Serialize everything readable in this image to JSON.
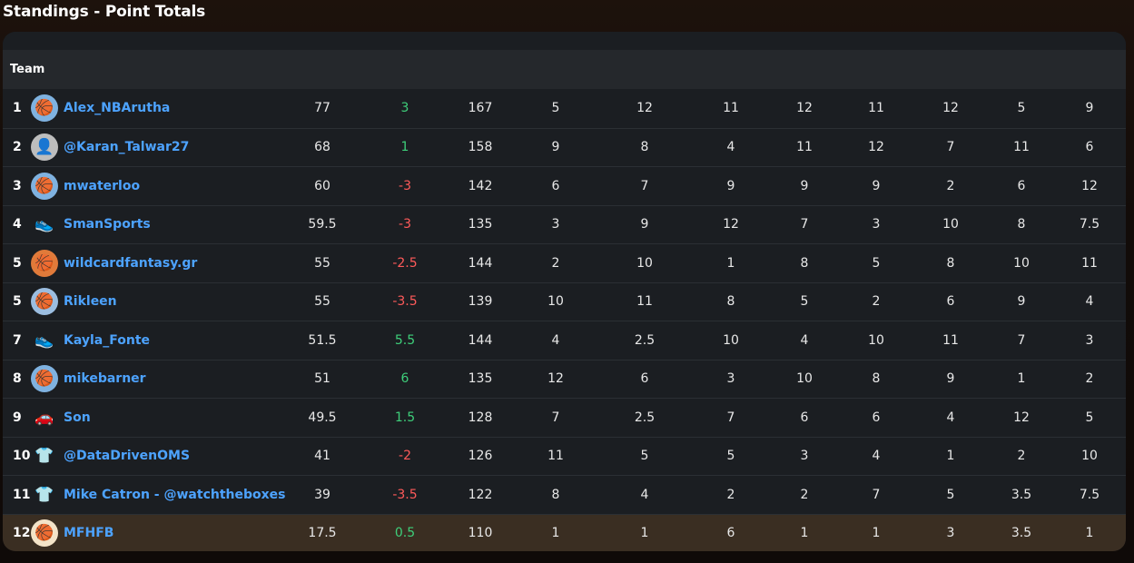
{
  "page": {
    "title": "Standings - Point Totals"
  },
  "table": {
    "header_team": "Team",
    "rows": [
      {
        "rank": "1",
        "team": "Alex_NBArutha",
        "avatar_icon": "basketball-hoop-icon",
        "avatar_glyph": "🏀",
        "avatar_bg": "#7fb2e0",
        "total": "77",
        "change": "3",
        "change_sign": "pos",
        "c1": "167",
        "c2": "5",
        "c3": "12",
        "c4": "11",
        "c5": "12",
        "c6": "11",
        "c7": "12",
        "c8": "5",
        "c9": "9"
      },
      {
        "rank": "2",
        "team": "@Karan_Talwar27",
        "avatar_icon": "person-photo-icon",
        "avatar_glyph": "👤",
        "avatar_bg": "#bdbdbd",
        "total": "68",
        "change": "1",
        "change_sign": "pos",
        "c1": "158",
        "c2": "9",
        "c3": "8",
        "c4": "4",
        "c5": "11",
        "c6": "12",
        "c7": "7",
        "c8": "11",
        "c9": "6"
      },
      {
        "rank": "3",
        "team": "mwaterloo",
        "avatar_icon": "basketball-hoop-icon",
        "avatar_glyph": "🏀",
        "avatar_bg": "#7fb2e0",
        "total": "60",
        "change": "-3",
        "change_sign": "neg",
        "c1": "142",
        "c2": "6",
        "c3": "7",
        "c4": "9",
        "c5": "9",
        "c6": "9",
        "c7": "2",
        "c8": "6",
        "c9": "12"
      },
      {
        "rank": "4",
        "team": "SmanSports",
        "avatar_icon": "sneaker-icon",
        "avatar_glyph": "👟",
        "avatar_bg": "transparent",
        "total": "59.5",
        "change": "-3",
        "change_sign": "neg",
        "c1": "135",
        "c2": "3",
        "c3": "9",
        "c4": "12",
        "c5": "7",
        "c6": "3",
        "c7": "10",
        "c8": "8",
        "c9": "7.5"
      },
      {
        "rank": "5",
        "team": "wildcardfantasy.gr",
        "avatar_icon": "basketball-icon",
        "avatar_glyph": "🏀",
        "avatar_bg": "#e07a3a",
        "total": "55",
        "change": "-2.5",
        "change_sign": "neg",
        "c1": "144",
        "c2": "2",
        "c3": "10",
        "c4": "1",
        "c5": "8",
        "c6": "5",
        "c7": "8",
        "c8": "10",
        "c9": "11"
      },
      {
        "rank": "5",
        "team": "Rikleen",
        "avatar_icon": "basketball-hoop-icon",
        "avatar_glyph": "🏀",
        "avatar_bg": "#9bbde0",
        "total": "55",
        "change": "-3.5",
        "change_sign": "neg",
        "c1": "139",
        "c2": "10",
        "c3": "11",
        "c4": "8",
        "c5": "5",
        "c6": "2",
        "c7": "6",
        "c8": "9",
        "c9": "4"
      },
      {
        "rank": "7",
        "team": "Kayla_Fonte",
        "avatar_icon": "sneaker-icon",
        "avatar_glyph": "👟",
        "avatar_bg": "transparent",
        "total": "51.5",
        "change": "5.5",
        "change_sign": "pos",
        "c1": "144",
        "c2": "4",
        "c3": "2.5",
        "c4": "10",
        "c5": "4",
        "c6": "10",
        "c7": "11",
        "c8": "7",
        "c9": "3"
      },
      {
        "rank": "8",
        "team": "mikebarner",
        "avatar_icon": "basketball-hoop-icon",
        "avatar_glyph": "🏀",
        "avatar_bg": "#7fb2e0",
        "total": "51",
        "change": "6",
        "change_sign": "pos",
        "c1": "135",
        "c2": "12",
        "c3": "6",
        "c4": "3",
        "c5": "10",
        "c6": "8",
        "c7": "9",
        "c8": "1",
        "c9": "2"
      },
      {
        "rank": "9",
        "team": "Son",
        "avatar_icon": "car-icon",
        "avatar_glyph": "🚗",
        "avatar_bg": "transparent",
        "total": "49.5",
        "change": "1.5",
        "change_sign": "pos",
        "c1": "128",
        "c2": "7",
        "c3": "2.5",
        "c4": "7",
        "c5": "6",
        "c6": "6",
        "c7": "4",
        "c8": "12",
        "c9": "5"
      },
      {
        "rank": "10",
        "team": "@DataDrivenOMS",
        "avatar_icon": "jersey-icon",
        "avatar_glyph": "👕",
        "avatar_bg": "transparent",
        "total": "41",
        "change": "-2",
        "change_sign": "neg",
        "c1": "126",
        "c2": "11",
        "c3": "5",
        "c4": "5",
        "c5": "3",
        "c6": "4",
        "c7": "1",
        "c8": "2",
        "c9": "10"
      },
      {
        "rank": "11",
        "team": "Mike Catron - @watchtheboxes",
        "avatar_icon": "jersey-icon",
        "avatar_glyph": "👕",
        "avatar_bg": "transparent",
        "total": "39",
        "change": "-3.5",
        "change_sign": "neg",
        "c1": "122",
        "c2": "8",
        "c3": "4",
        "c4": "2",
        "c5": "2",
        "c6": "7",
        "c7": "5",
        "c8": "3.5",
        "c9": "7.5"
      },
      {
        "rank": "12",
        "team": "MFHFB",
        "avatar_icon": "basketball-logo-icon",
        "avatar_glyph": "🏀",
        "avatar_bg": "#f3e3c8",
        "total": "17.5",
        "change": "0.5",
        "change_sign": "pos",
        "c1": "110",
        "c2": "1",
        "c3": "1",
        "c4": "6",
        "c5": "1",
        "c6": "1",
        "c7": "3",
        "c8": "3.5",
        "c9": "1",
        "highlight": true
      }
    ]
  },
  "colors": {
    "link": "#4da3ff",
    "positive": "#3ecf7a",
    "negative": "#ff5a5a",
    "highlight_row": "#3a2e22"
  }
}
